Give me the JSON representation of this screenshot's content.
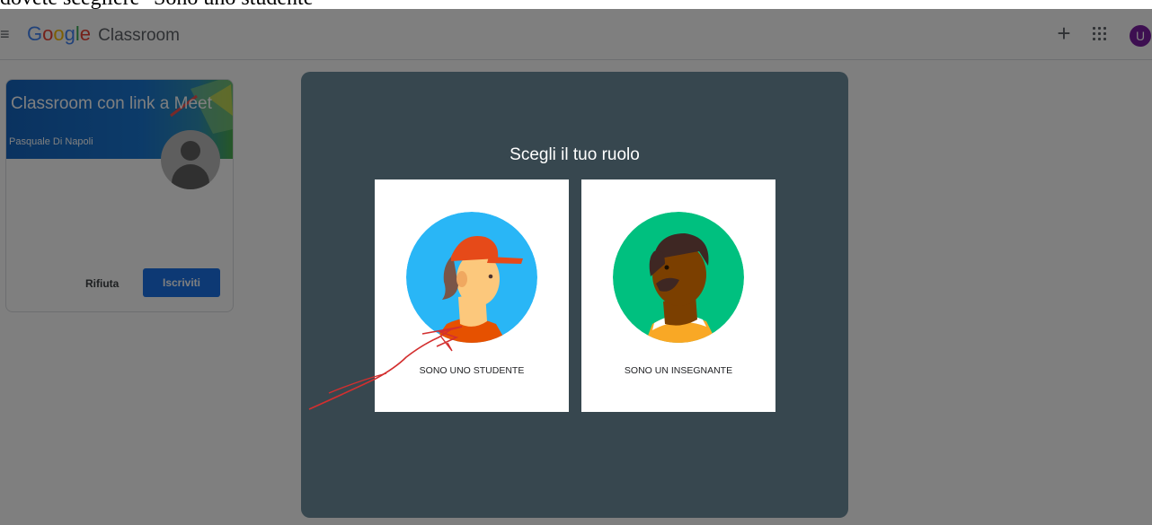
{
  "caption": "dovete scegliere \"Sono uno studente\"",
  "header": {
    "logo_google": [
      "G",
      "o",
      "o",
      "g",
      "l",
      "e"
    ],
    "product": "Classroom",
    "menu_icon": "hamburger-menu-icon",
    "create_icon": "plus-icon",
    "apps_icon": "apps-grid-icon",
    "account_initial": "U"
  },
  "class_card": {
    "title": "Classroom con link a Meet",
    "teacher": "Pasquale Di Napoli",
    "reject_label": "Rifiuta",
    "join_label": "Iscriviti"
  },
  "dialog": {
    "title": "Scegli il tuo ruolo",
    "roles": [
      {
        "label": "SONO UNO STUDENTE",
        "icon": "student-illustration"
      },
      {
        "label": "SONO UN INSEGNANTE",
        "icon": "teacher-illustration"
      }
    ]
  },
  "colors": {
    "brand_blue": "#1a73e8",
    "dialog_bg": "#37474f",
    "annotation_red": "#d32f2f",
    "student_bg": "#29b6f6",
    "teacher_bg": "#00c07f"
  }
}
